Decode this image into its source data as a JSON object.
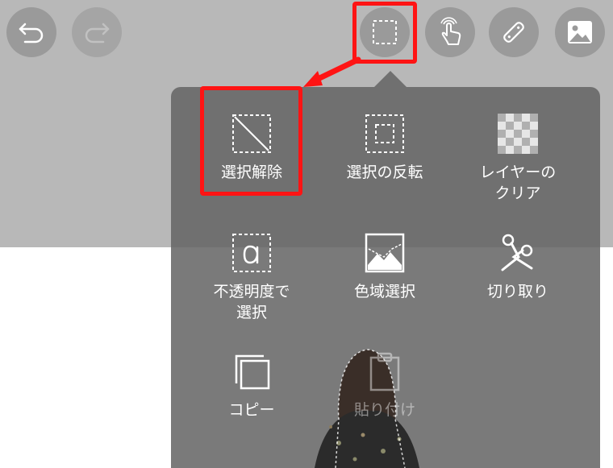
{
  "menu": {
    "items": [
      {
        "label": "選択解除",
        "icon": "deselect-icon"
      },
      {
        "label": "選択の反転",
        "icon": "invert-selection-icon"
      },
      {
        "label": "レイヤーの\nクリア",
        "icon": "clear-layer-icon"
      },
      {
        "label": "不透明度で\n選択",
        "icon": "select-by-opacity-icon"
      },
      {
        "label": "色域選択",
        "icon": "color-range-icon"
      },
      {
        "label": "切り取り",
        "icon": "scissors-icon"
      },
      {
        "label": "コピー",
        "icon": "copy-icon"
      },
      {
        "label": "貼り付け",
        "icon": "paste-icon"
      }
    ]
  },
  "colors": {
    "highlight": "#ff1414",
    "panel": "#646464",
    "toolbar_band": "#b8b8b8",
    "button": "#9a9a9a",
    "text": "#ffffff"
  }
}
